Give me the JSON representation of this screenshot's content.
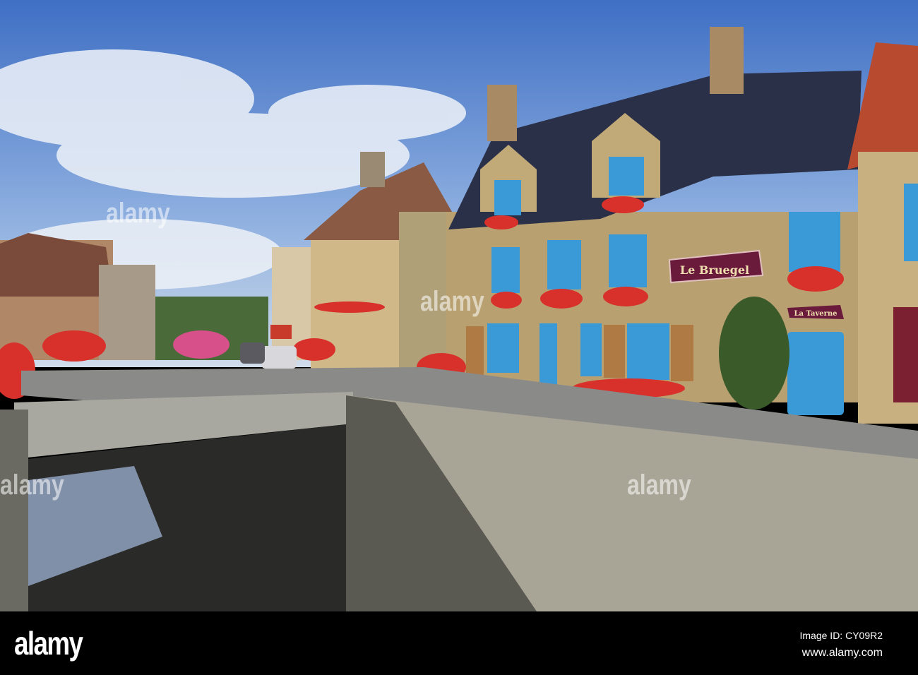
{
  "photo": {
    "signs": {
      "restaurant": "Le Bruegel",
      "tavern": "La Taverne"
    },
    "colors": {
      "sky": "#4a78c8",
      "roof": "#2a3048",
      "brick": "#b8a070",
      "shutter": "#3a9ad8",
      "sign": "#6a1a3a",
      "flowers": "#d8302a"
    }
  },
  "watermark": {
    "text": "alamy"
  },
  "footer": {
    "logo": "alamy",
    "image_id": "Image ID: CY09R2",
    "url": "www.alamy.com"
  }
}
